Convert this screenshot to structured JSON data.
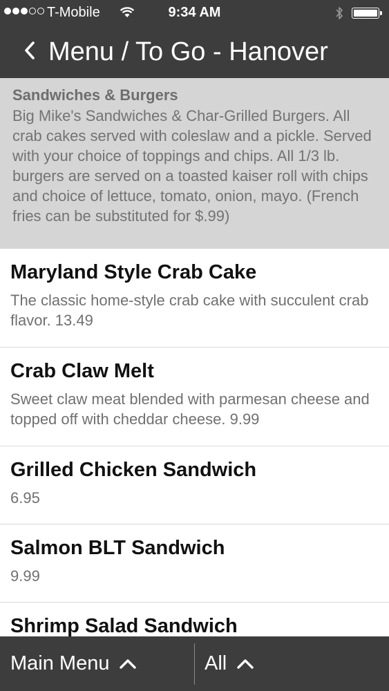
{
  "status_bar": {
    "carrier": "T-Mobile",
    "time": "9:34 AM",
    "signal_bars_filled": 3,
    "signal_bars_total": 5
  },
  "header": {
    "title": "Menu / To Go - Hanover"
  },
  "category": {
    "title": "Sandwiches & Burgers",
    "description": "Big Mike's Sandwiches & Char-Grilled Burgers. All crab cakes served with coleslaw and a pickle. Served with your choice of toppings and chips. All 1/3 lb. burgers are served on a toasted kaiser roll with chips and choice of lettuce, tomato, onion, mayo. (French fries can be substituted for $.99)"
  },
  "menu_items": [
    {
      "name": "Maryland Style Crab Cake",
      "description": "The classic home-style crab cake with succulent crab flavor. 13.49"
    },
    {
      "name": "Crab Claw Melt",
      "description": "Sweet claw meat blended with parmesan cheese and topped off with cheddar cheese. 9.99"
    },
    {
      "name": "Grilled Chicken Sandwich",
      "description": "6.95"
    },
    {
      "name": "Salmon BLT Sandwich",
      "description": "9.99"
    },
    {
      "name": "Shrimp Salad Sandwich",
      "description": ""
    }
  ],
  "toolbar": {
    "main_menu_label": "Main Menu",
    "filter_label": "All"
  },
  "colors": {
    "bar_background": "#3e3d3e",
    "category_background": "#d5d5d5",
    "text_dark": "#111111",
    "text_muted": "#707070"
  }
}
